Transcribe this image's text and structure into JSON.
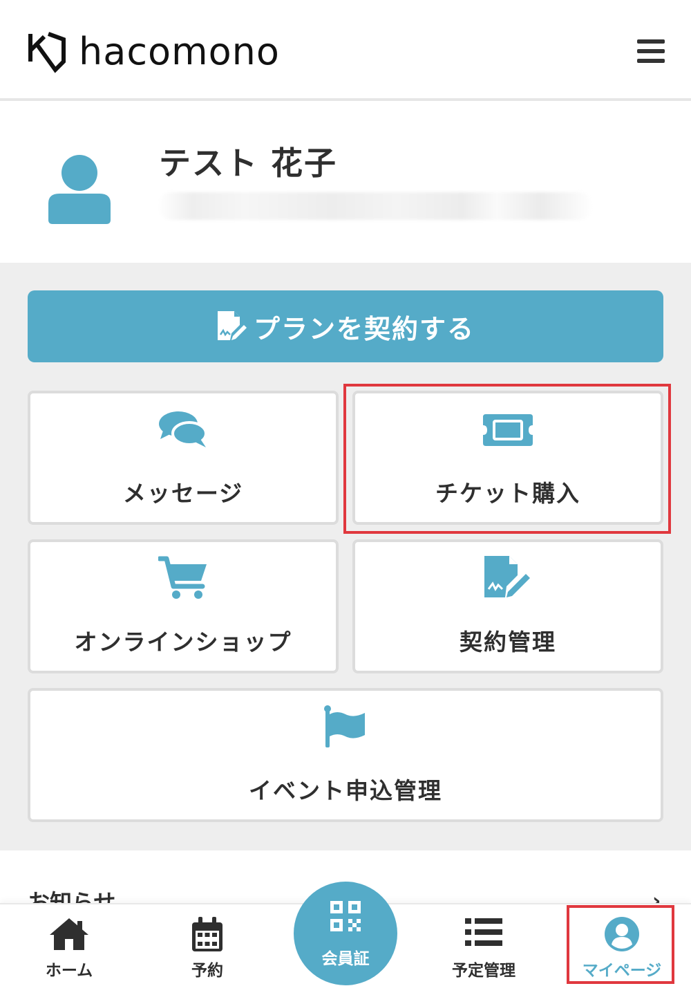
{
  "header": {
    "logo_text": "hacomono",
    "menu_icon": "hamburger-menu-icon"
  },
  "profile": {
    "name": "テスト 花子",
    "sub_info": "",
    "avatar_icon": "user-avatar-icon"
  },
  "plan_button": {
    "label": "プランを契約する",
    "icon": "contract-sign-icon"
  },
  "menu": {
    "message": {
      "label": "メッセージ",
      "icon": "chat-bubbles-icon"
    },
    "ticket": {
      "label": "チケット購入",
      "icon": "ticket-icon"
    },
    "shop": {
      "label": "オンラインショップ",
      "icon": "shopping-cart-icon"
    },
    "contract": {
      "label": "契約管理",
      "icon": "contract-sign-icon"
    },
    "event": {
      "label": "イベント申込管理",
      "icon": "flag-icon"
    }
  },
  "news": {
    "title": "お知らせ",
    "chevron": "›"
  },
  "bottom_nav": {
    "home": {
      "label": "ホーム",
      "icon": "home-icon"
    },
    "reserve": {
      "label": "予約",
      "icon": "calendar-icon"
    },
    "member_card": {
      "label": "会員証",
      "icon": "qr-code-icon"
    },
    "schedule": {
      "label": "予定管理",
      "icon": "list-icon"
    },
    "mypage": {
      "label": "マイページ",
      "icon": "user-circle-icon"
    }
  },
  "colors": {
    "accent": "#55abc8",
    "highlight": "#e0383e",
    "background_gray": "#eeeeee",
    "text": "#2f2f2f"
  }
}
